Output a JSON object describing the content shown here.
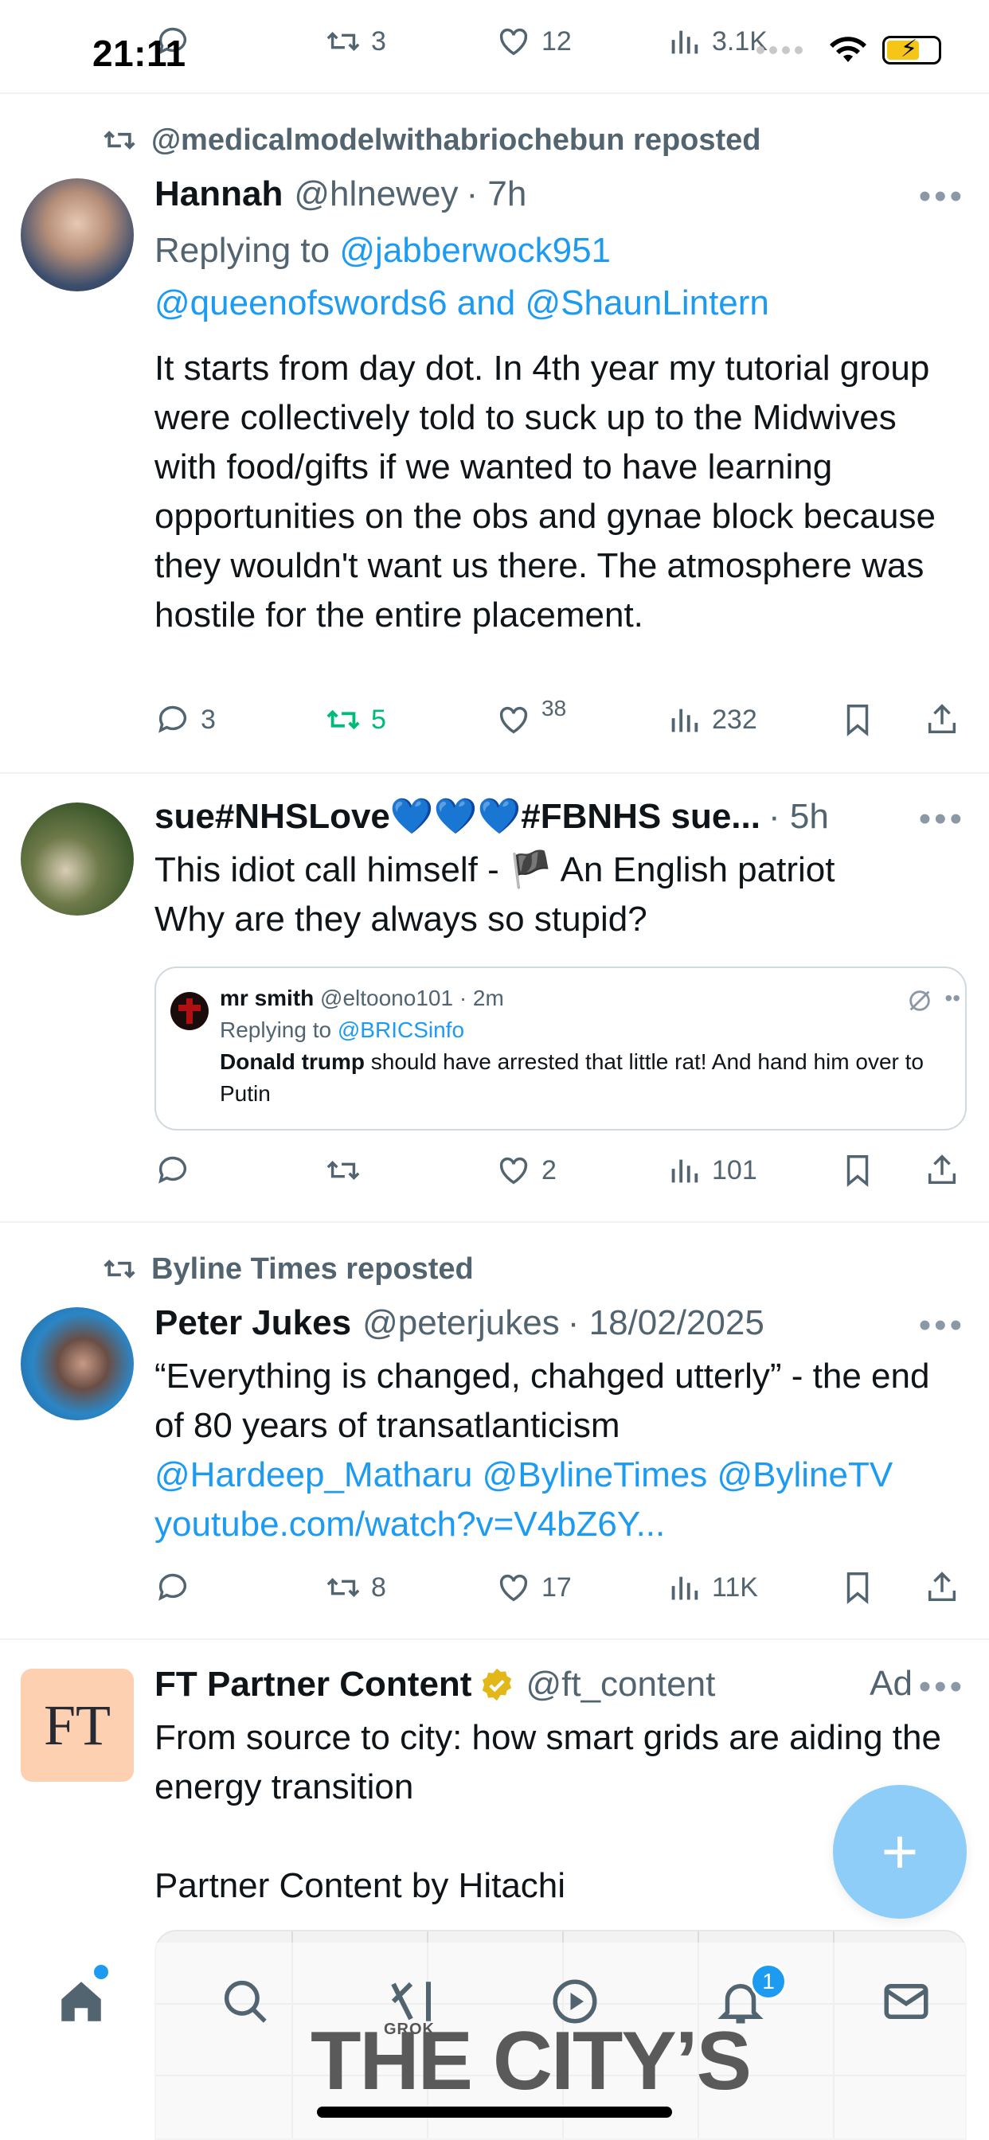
{
  "status_bar": {
    "time": "21:11"
  },
  "top_partial": {
    "reply_count": "",
    "retweet_count": "3",
    "like_count": "12",
    "views": "3.1K"
  },
  "tweet1": {
    "repost_label": "@medicalmodelwithabriochebun reposted",
    "name": "Hannah",
    "handle": "@hlnewey",
    "time": "· 7h",
    "replying_prefix": "Replying to",
    "replying_to_1": "@jabberwock951",
    "replying_to_2": "@queenofswords6",
    "replying_and": "and",
    "replying_to_3": "@ShaunLintern",
    "text": "It starts from day dot. In 4th year my tutorial group were collectively told to suck up to the Midwives with food/gifts if we wanted to have learning opportunities on the obs and gynae block because they wouldn't want us there. The atmosphere was hostile for the entire placement.",
    "replies": "3",
    "retweets": "5",
    "likes": "38",
    "views": "232"
  },
  "tweet2": {
    "name": "sue#NHSLove💙💙💙#FBNHS sue...",
    "time": "· 5h",
    "text_line1": "This idiot call himself - 🏴 An English patriot",
    "text_line2": "Why are they always so stupid?",
    "quote": {
      "name": "mr smith",
      "handle": "@eltoono101",
      "time": "· 2m",
      "replying_prefix": "Replying to",
      "replying_to": "@BRICSinfo",
      "bold": "Donald trump",
      "text": " should have arrested that little rat! And hand him over to Putin"
    },
    "replies": "",
    "retweets": "",
    "likes": "2",
    "views": "101"
  },
  "tweet3": {
    "repost_label": "Byline Times reposted",
    "name": "Peter Jukes",
    "handle": "@peterjukes",
    "time": "· 18/02/2025",
    "text": "“Everything is changed, chahged utterly” - the end of 80 years of transatlanticism",
    "mention1": "@Hardeep_Matharu",
    "mention2": "@BylineTimes",
    "mention3": "@BylineTV",
    "url": "youtube.com/watch?v=V4bZ6Y...",
    "replies": "",
    "retweets": "8",
    "likes": "17",
    "views": "11K"
  },
  "tweet4": {
    "avatar_text": "FT",
    "name": "FT Partner Content",
    "handle": "@ft_content",
    "ad_label": "Ad",
    "text_line1": "From source to city: how smart grids are aiding the energy transition",
    "text_line2": "Partner Content by Hitachi",
    "card_headline": "THE CITY’S"
  },
  "tabbar": {
    "grok_label": "GROK",
    "notification_count": "1"
  },
  "colors": {
    "accent": "#1d9bf0",
    "retweet_active": "#00ba7c",
    "muted": "#536471",
    "fab": "#8ecdf7"
  }
}
